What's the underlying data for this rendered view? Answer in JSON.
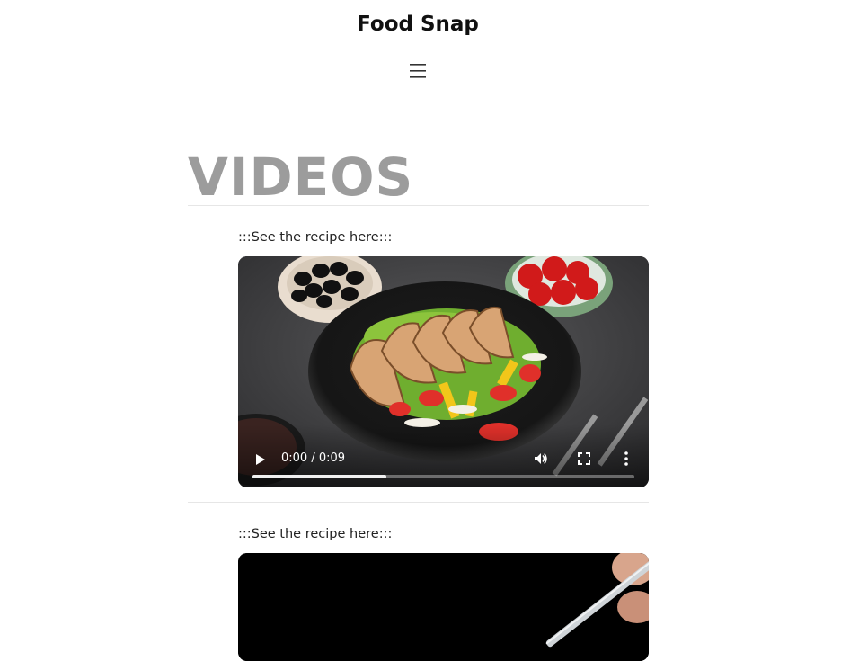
{
  "header": {
    "site_title": "Food Snap",
    "menu_icon": "hamburger-menu-icon"
  },
  "page": {
    "section_title": "VIDEOS"
  },
  "videos": [
    {
      "link_text": ":::See the recipe here:::",
      "thumbnail": "grilled chicken salad with olives and tomatoes",
      "time_display": "0:00 / 0:09",
      "buffered_fraction": 0.35,
      "controls": {
        "play_icon": "play-icon",
        "volume_icon": "volume-icon",
        "fullscreen_icon": "fullscreen-icon",
        "more_icon": "more-options-icon"
      }
    },
    {
      "link_text": ":::See the recipe here:::",
      "thumbnail": "hand holding a fork against dark background"
    }
  ]
}
